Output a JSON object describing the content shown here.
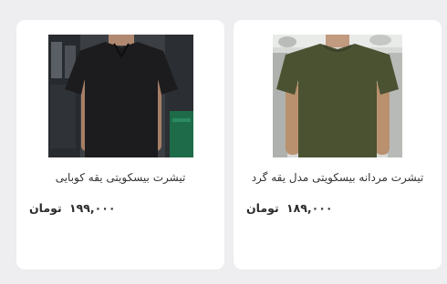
{
  "products": [
    {
      "name": "تیشرت بیسکویتی یقه کوبایی",
      "price": "۱۹۹,۰۰۰",
      "currency": "تومان",
      "shirt_color": "#1c1c1e"
    },
    {
      "name": "تیشرت مردانه بیسکویتی مدل یقه گرد",
      "price": "۱۸۹,۰۰۰",
      "currency": "تومان",
      "shirt_color": "#4b5232"
    }
  ],
  "colors": {
    "page_background": "#eeeef0",
    "card_background": "#ffffff",
    "text": "#333333"
  }
}
